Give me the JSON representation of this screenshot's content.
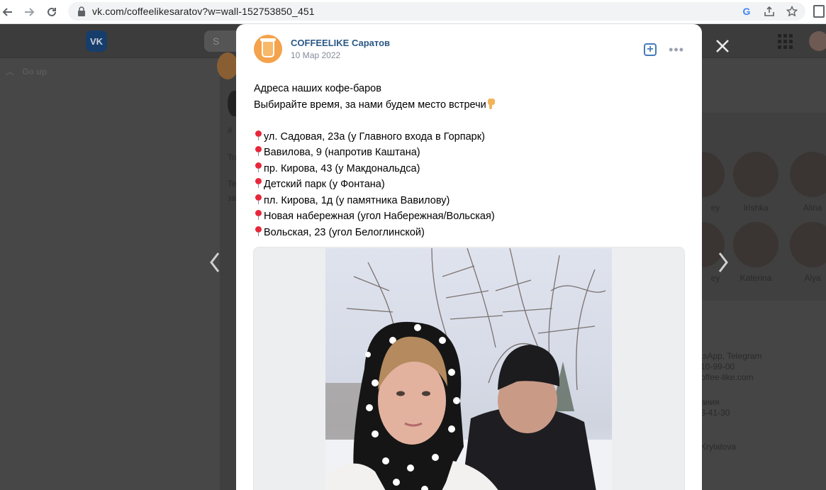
{
  "browser": {
    "url": "vk.com/coffeelikesaratov?w=wall-152753850_451"
  },
  "background": {
    "logo_label": "VK",
    "search_label": "S",
    "go_up": "Go up",
    "fragments": [
      "#",
      "To",
      "Te",
      "за"
    ],
    "members": [
      {
        "name": "ey"
      },
      {
        "name": "Irishka"
      },
      {
        "name": "Alina"
      },
      {
        "name": "ey"
      },
      {
        "name": "Katerina"
      },
      {
        "name": "Alya"
      }
    ],
    "contacts": [
      "tsApp, Telegram",
      "10-99-00",
      "offee-like.com",
      "ания",
      "3-41-30",
      "Krylatova"
    ]
  },
  "post": {
    "author": "COFFEELIKE Саратов",
    "date": "10 Мар 2022",
    "add_label": "+",
    "more_label": "•••",
    "title_line": "Адреса наших кофе-баров",
    "subtitle_line": "Выбирайте время, за нами будем место встречи",
    "addresses": [
      "ул. Садовая, 23а (у Главного входа в Горпарк)",
      "Вавилова, 9 (напротив Каштана)",
      "пр. Кирова, 43 (у Макдональдса)",
      "Детский парк (у Фонтана)",
      "пл. Кирова, 1д (у памятника Вавилову)",
      "Новая набережная (угол Набережная/Вольская)",
      "Вольская, 23 (угол Белоглинской)"
    ]
  }
}
